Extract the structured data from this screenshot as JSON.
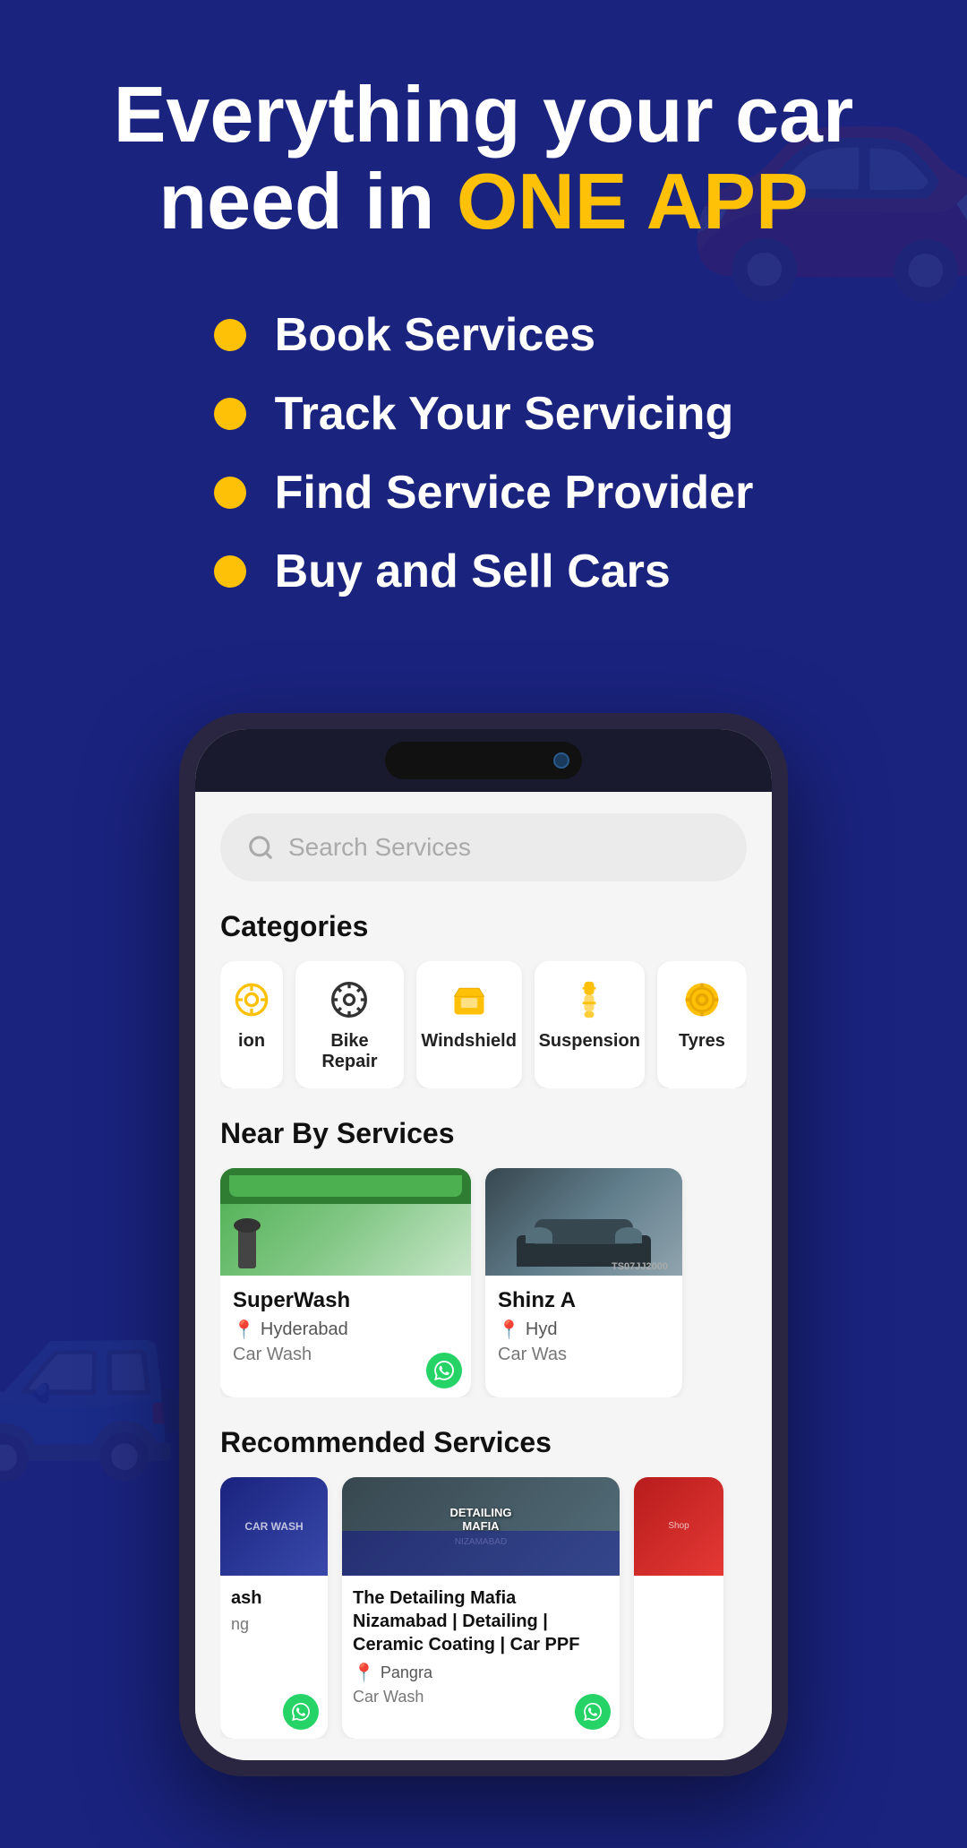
{
  "hero": {
    "title_line1": "Everything your car",
    "title_line2": "need in ",
    "title_highlight": "ONE APP",
    "features": [
      "Book Services",
      "Track Your Servicing",
      "Find Service Provider",
      "Buy and Sell Cars"
    ]
  },
  "app": {
    "search": {
      "placeholder": "Search Services"
    },
    "categories": {
      "label": "Categories",
      "items": [
        {
          "name": "ion",
          "icon": "⚙️",
          "icon_type": "partial"
        },
        {
          "name": "Bike Repair",
          "icon": "⚙",
          "icon_type": "gear"
        },
        {
          "name": "Windshield",
          "icon": "🔧",
          "icon_type": "windshield"
        },
        {
          "name": "Suspension",
          "icon": "🔩",
          "icon_type": "suspension"
        },
        {
          "name": "Tyres",
          "icon": "⭕",
          "icon_type": "tyre"
        }
      ]
    },
    "nearby": {
      "label": "Near By Services",
      "items": [
        {
          "name": "SuperWash",
          "location": "Hyderabad",
          "type": "Car Wash"
        },
        {
          "name": "Shinz A",
          "location": "Hyd",
          "type": "Car Was"
        }
      ]
    },
    "recommended": {
      "label": "Recommended Services",
      "items": [
        {
          "name": "ash",
          "sub": "ng",
          "partial": true
        },
        {
          "name": "The Detailing Mafia Nizamabad | Detailing | Ceramic Coating | Car PPF",
          "location": "Pangra",
          "type": "Car Wash",
          "img_label": "DETAILING MAFIA"
        },
        {
          "name": "...",
          "partial": true
        }
      ]
    }
  }
}
